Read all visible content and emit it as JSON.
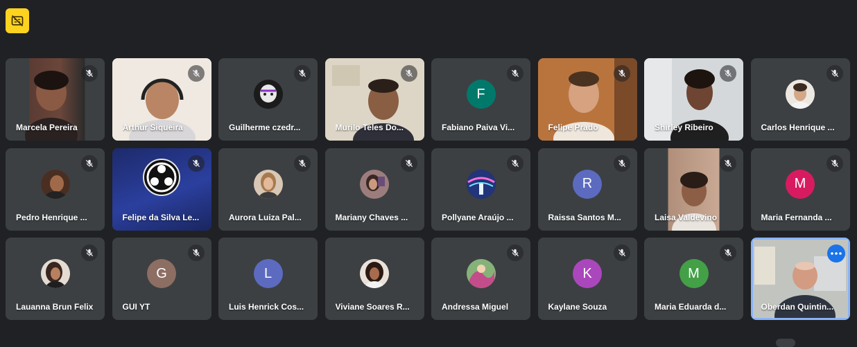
{
  "toolbar": {
    "captions_icon": "closed-captions-off-icon",
    "accent": "#fdd31f"
  },
  "participants": [
    {
      "name": "Marcela Pereira",
      "muted": true,
      "kind": "video"
    },
    {
      "name": "Arthur Siqueira",
      "muted": true,
      "kind": "video"
    },
    {
      "name": "Guilherme czedr...",
      "muted": true,
      "kind": "photo"
    },
    {
      "name": "Murilo Teles Do...",
      "muted": true,
      "kind": "video"
    },
    {
      "name": "Fabiano Paiva Vi...",
      "muted": true,
      "kind": "initial",
      "initial": "F",
      "color": "#00796b"
    },
    {
      "name": "Felipe Prado",
      "muted": true,
      "kind": "video"
    },
    {
      "name": "Shirley Ribeiro",
      "muted": true,
      "kind": "video"
    },
    {
      "name": "Carlos Henrique ...",
      "muted": true,
      "kind": "photo"
    },
    {
      "name": "Pedro Henrique ...",
      "muted": true,
      "kind": "photo"
    },
    {
      "name": "Felipe da Silva Le...",
      "muted": true,
      "kind": "video"
    },
    {
      "name": "Aurora Luiza Pal...",
      "muted": true,
      "kind": "photo"
    },
    {
      "name": "Mariany Chaves ...",
      "muted": true,
      "kind": "photo"
    },
    {
      "name": "Pollyane Araújo ...",
      "muted": true,
      "kind": "photo"
    },
    {
      "name": "Raissa Santos M...",
      "muted": true,
      "kind": "initial",
      "initial": "R",
      "color": "#5c6bc0"
    },
    {
      "name": "Laisa Valdevino",
      "muted": true,
      "kind": "video"
    },
    {
      "name": "Maria Fernanda ...",
      "muted": true,
      "kind": "initial",
      "initial": "M",
      "color": "#d81b60"
    },
    {
      "name": "Lauanna Brun Felix",
      "muted": true,
      "kind": "photo"
    },
    {
      "name": "GUI YT",
      "muted": true,
      "kind": "initial",
      "initial": "G",
      "color": "#8d6e63"
    },
    {
      "name": "Luis Henrick Cos...",
      "muted": false,
      "kind": "initial",
      "initial": "L",
      "color": "#5c6bc0"
    },
    {
      "name": "Viviane Soares R...",
      "muted": false,
      "kind": "photo"
    },
    {
      "name": "Andressa Miguel",
      "muted": true,
      "kind": "photo"
    },
    {
      "name": "Kaylane Souza",
      "muted": true,
      "kind": "initial",
      "initial": "K",
      "color": "#ab47bc"
    },
    {
      "name": "Maria Eduarda d...",
      "muted": true,
      "kind": "initial",
      "initial": "M",
      "color": "#43a047"
    },
    {
      "name": "Oberdan Quintin...",
      "muted": false,
      "kind": "video",
      "active": true
    }
  ]
}
